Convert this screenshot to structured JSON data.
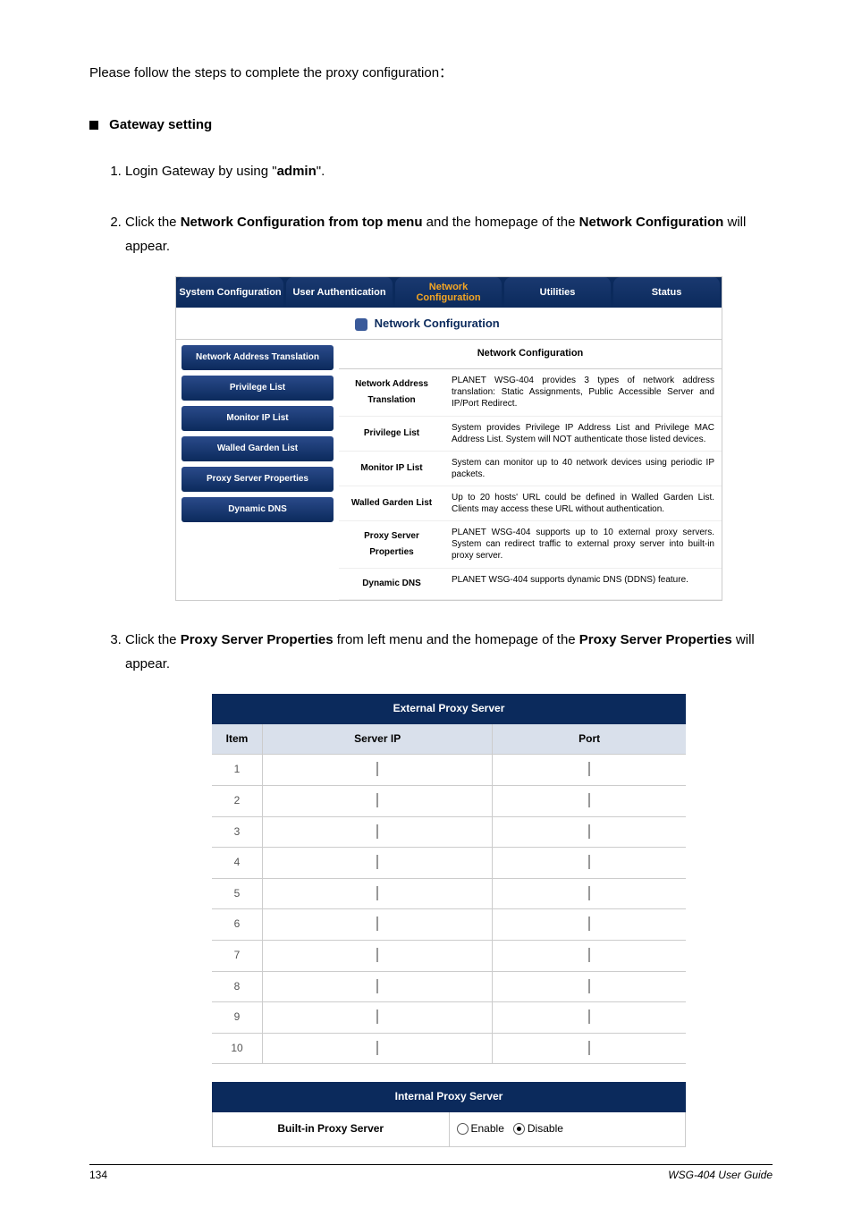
{
  "intro": "Please follow the steps to complete the proxy configuration：",
  "section_heading": "Gateway setting",
  "steps": {
    "s1_a": "Login Gateway by using \"",
    "s1_b": "admin",
    "s1_c": "\".",
    "s2_a": "Click the ",
    "s2_b": "Network Configuration from top menu",
    "s2_c": " and the homepage of the ",
    "s2_d": "Network Configuration",
    "s2_e": " will appear.",
    "s3_a": "Click the ",
    "s3_b": "Proxy Server Properties",
    "s3_c": " from left menu and the homepage of the ",
    "s3_d": "Proxy Server Properties",
    "s3_e": " will appear."
  },
  "topnav": {
    "tabs": {
      "t0": "System Configuration",
      "t1": "User Authentication",
      "t2": "Network Configuration",
      "t3": "Utilities",
      "t4": "Status"
    },
    "title": "Network Configuration"
  },
  "leftnav": {
    "i0": "Network Address Translation",
    "i1": "Privilege List",
    "i2": "Monitor IP List",
    "i3": "Walled Garden List",
    "i4": "Proxy Server Properties",
    "i5": "Dynamic DNS"
  },
  "ncright": {
    "header": "Network Configuration",
    "rows": {
      "r0": {
        "label": "Network Address Translation",
        "desc": "PLANET  WSG-404 provides 3 types of network address translation: Static Assignments, Public Accessible Server and IP/Port Redirect."
      },
      "r1": {
        "label": "Privilege List",
        "desc": "System provides Privilege IP Address List and Privilege MAC Address List. System will NOT authenticate those listed devices."
      },
      "r2": {
        "label": "Monitor IP List",
        "desc": "System can monitor up to 40 network devices using periodic IP packets."
      },
      "r3": {
        "label": "Walled Garden List",
        "desc": "Up to 20 hosts' URL could be defined in Walled Garden List. Clients may access these URL without authentication."
      },
      "r4": {
        "label": "Proxy Server Properties",
        "desc": "PLANET  WSG-404 supports up to 10 external proxy servers. System can redirect traffic to external proxy server into built-in proxy server."
      },
      "r5": {
        "label": "Dynamic DNS",
        "desc": "PLANET  WSG-404 supports dynamic DNS (DDNS) feature."
      }
    }
  },
  "external_proxy": {
    "title": "External Proxy Server",
    "col_item": "Item",
    "col_ip": "Server IP",
    "col_port": "Port",
    "rows": [
      "1",
      "2",
      "3",
      "4",
      "5",
      "6",
      "7",
      "8",
      "9",
      "10"
    ]
  },
  "internal_proxy": {
    "title": "Internal Proxy Server",
    "label": "Built-in Proxy Server",
    "opt_enable": "Enable",
    "opt_disable": "Disable"
  },
  "footer": {
    "page": "134",
    "doc": "WSG-404  User Guide"
  }
}
